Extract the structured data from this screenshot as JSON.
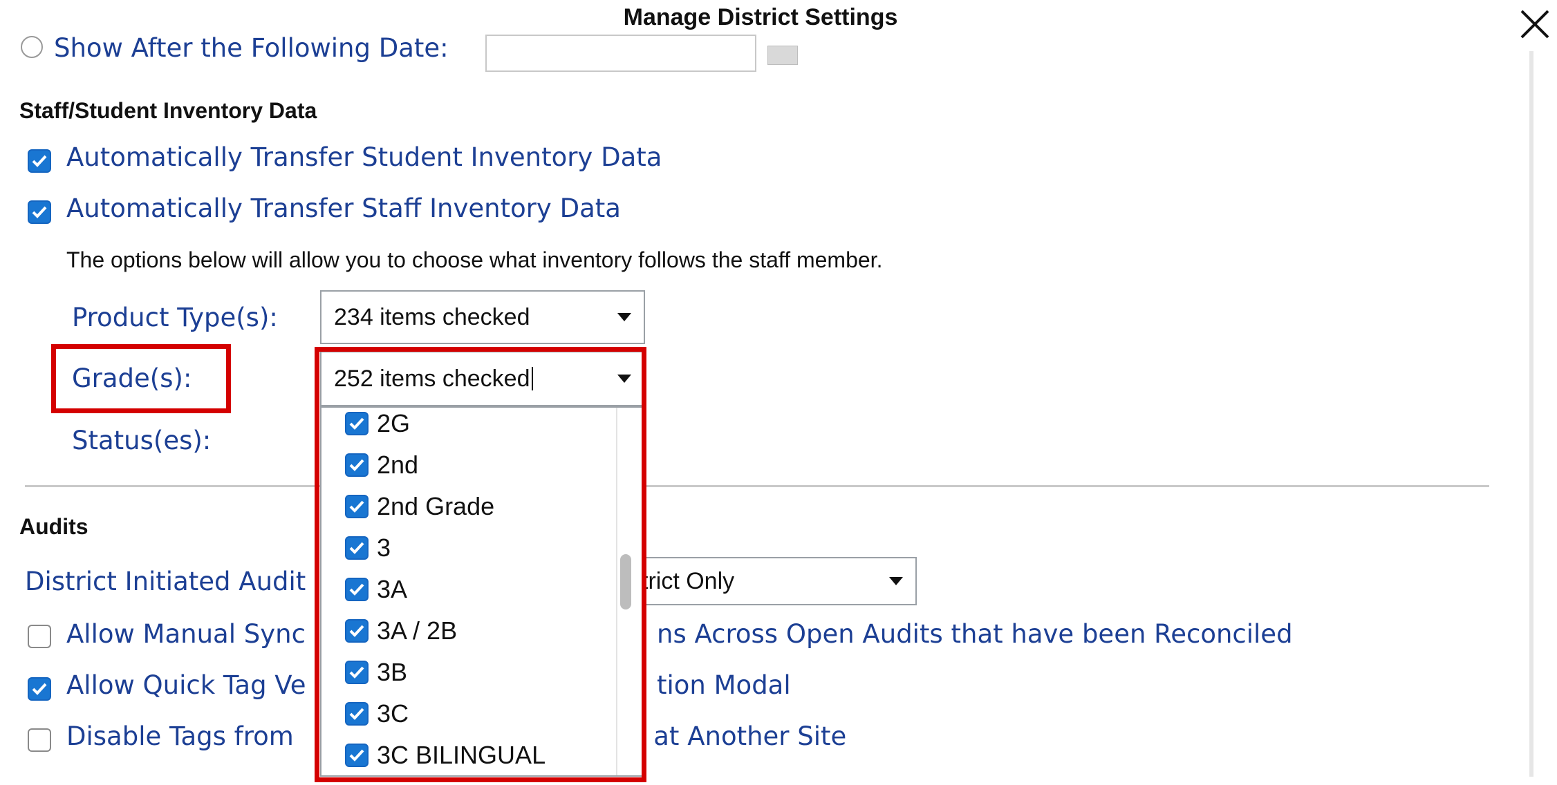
{
  "dialog": {
    "title": "Manage District Settings",
    "close_icon": "close-icon"
  },
  "top": {
    "show_after_label": "Show After the Following Date:",
    "date_value": ""
  },
  "inventory": {
    "heading": "Staff/Student Inventory Data",
    "student_transfer_label": "Automatically Transfer Student Inventory Data",
    "student_transfer_checked": true,
    "staff_transfer_label": "Automatically Transfer Staff Inventory Data",
    "staff_transfer_checked": true,
    "note": "The options below will allow you to choose what inventory follows the staff member.",
    "product_types_label": "Product Type(s):",
    "product_types_value": "234 items checked",
    "grades_label": "Grade(s):",
    "grades_value": "252 items checked",
    "statuses_label": "Status(es):"
  },
  "grades_dropdown": {
    "items": [
      {
        "label": "2G",
        "checked": true
      },
      {
        "label": "2nd",
        "checked": true
      },
      {
        "label": "2nd Grade",
        "checked": true
      },
      {
        "label": "3",
        "checked": true
      },
      {
        "label": "3A",
        "checked": true
      },
      {
        "label": "3A / 2B",
        "checked": true
      },
      {
        "label": "3B",
        "checked": true
      },
      {
        "label": "3C",
        "checked": true
      },
      {
        "label": "3C BILINGUAL",
        "checked": true
      }
    ]
  },
  "audits": {
    "heading": "Audits",
    "district_initiated_label": "District Initiated Audit",
    "district_initiated_value": "trict Only",
    "manual_sync_label_left": "Allow Manual Sync",
    "manual_sync_label_right": "ns Across Open Audits that have been Reconciled",
    "manual_sync_checked": false,
    "quick_tag_label_left": "Allow Quick Tag Ve",
    "quick_tag_label_right": "tion Modal",
    "quick_tag_checked": true,
    "disable_tags_label_left": "Disable Tags from",
    "disable_tags_label_right": "d at Another Site",
    "disable_tags_checked": false
  },
  "colors": {
    "link_blue": "#1c3f94",
    "checkbox_blue": "#1976d2",
    "highlight_red": "#d40000"
  }
}
